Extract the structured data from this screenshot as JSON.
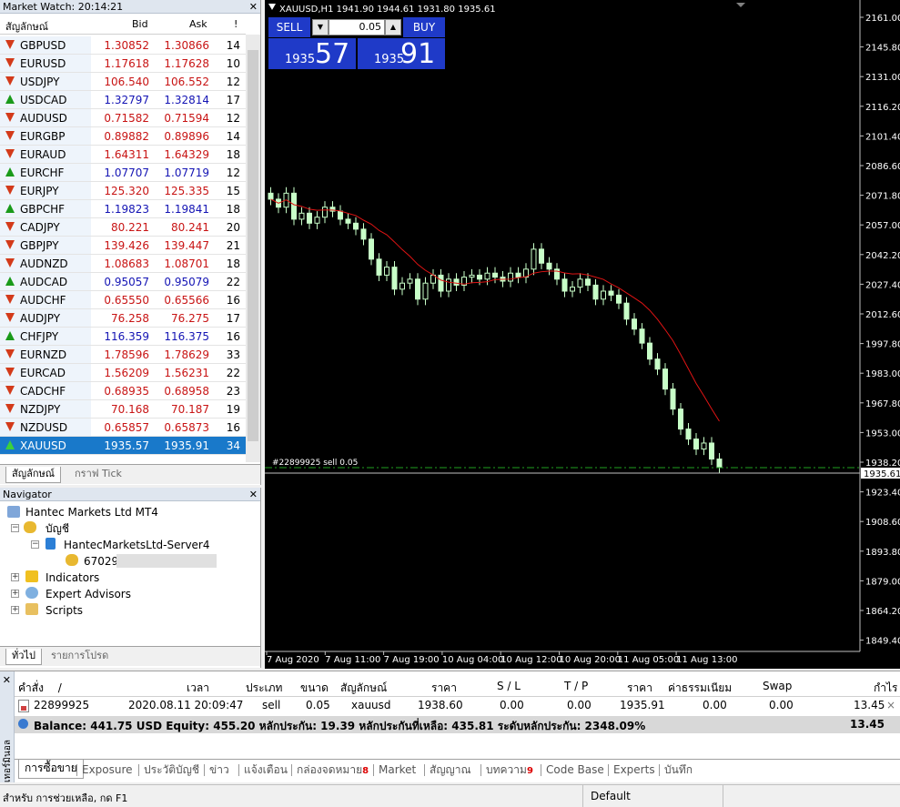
{
  "market_watch": {
    "title": "Market Watch: 20:14:21",
    "col_symbol": "สัญลักษณ์",
    "col_bid": "Bid",
    "col_ask": "Ask",
    "col_spread": "!",
    "rows": [
      {
        "symbol": "GBPUSD",
        "bid": "1.30852",
        "ask": "1.30866",
        "spread": "14",
        "dir": "down"
      },
      {
        "symbol": "EURUSD",
        "bid": "1.17618",
        "ask": "1.17628",
        "spread": "10",
        "dir": "down"
      },
      {
        "symbol": "USDJPY",
        "bid": "106.540",
        "ask": "106.552",
        "spread": "12",
        "dir": "down"
      },
      {
        "symbol": "USDCAD",
        "bid": "1.32797",
        "ask": "1.32814",
        "spread": "17",
        "dir": "up"
      },
      {
        "symbol": "AUDUSD",
        "bid": "0.71582",
        "ask": "0.71594",
        "spread": "12",
        "dir": "down"
      },
      {
        "symbol": "EURGBP",
        "bid": "0.89882",
        "ask": "0.89896",
        "spread": "14",
        "dir": "down"
      },
      {
        "symbol": "EURAUD",
        "bid": "1.64311",
        "ask": "1.64329",
        "spread": "18",
        "dir": "down"
      },
      {
        "symbol": "EURCHF",
        "bid": "1.07707",
        "ask": "1.07719",
        "spread": "12",
        "dir": "up"
      },
      {
        "symbol": "EURJPY",
        "bid": "125.320",
        "ask": "125.335",
        "spread": "15",
        "dir": "down"
      },
      {
        "symbol": "GBPCHF",
        "bid": "1.19823",
        "ask": "1.19841",
        "spread": "18",
        "dir": "up"
      },
      {
        "symbol": "CADJPY",
        "bid": "80.221",
        "ask": "80.241",
        "spread": "20",
        "dir": "down"
      },
      {
        "symbol": "GBPJPY",
        "bid": "139.426",
        "ask": "139.447",
        "spread": "21",
        "dir": "down"
      },
      {
        "symbol": "AUDNZD",
        "bid": "1.08683",
        "ask": "1.08701",
        "spread": "18",
        "dir": "down"
      },
      {
        "symbol": "AUDCAD",
        "bid": "0.95057",
        "ask": "0.95079",
        "spread": "22",
        "dir": "up"
      },
      {
        "symbol": "AUDCHF",
        "bid": "0.65550",
        "ask": "0.65566",
        "spread": "16",
        "dir": "down"
      },
      {
        "symbol": "AUDJPY",
        "bid": "76.258",
        "ask": "76.275",
        "spread": "17",
        "dir": "down"
      },
      {
        "symbol": "CHFJPY",
        "bid": "116.359",
        "ask": "116.375",
        "spread": "16",
        "dir": "up"
      },
      {
        "symbol": "EURNZD",
        "bid": "1.78596",
        "ask": "1.78629",
        "spread": "33",
        "dir": "down"
      },
      {
        "symbol": "EURCAD",
        "bid": "1.56209",
        "ask": "1.56231",
        "spread": "22",
        "dir": "down"
      },
      {
        "symbol": "CADCHF",
        "bid": "0.68935",
        "ask": "0.68958",
        "spread": "23",
        "dir": "down"
      },
      {
        "symbol": "NZDJPY",
        "bid": "70.168",
        "ask": "70.187",
        "spread": "19",
        "dir": "down"
      },
      {
        "symbol": "NZDUSD",
        "bid": "0.65857",
        "ask": "0.65873",
        "spread": "16",
        "dir": "down"
      },
      {
        "symbol": "XAUUSD",
        "bid": "1935.57",
        "ask": "1935.91",
        "spread": "34",
        "dir": "up",
        "selected": true
      }
    ],
    "tab_symbols": "สัญลักษณ์",
    "tab_tick": "กราฟ Tick"
  },
  "navigator": {
    "title": "Navigator",
    "root": "Hantec Markets Ltd MT4",
    "accounts": "บัญชี",
    "server": "HantecMarketsLtd-Server4",
    "account_no": "67029:",
    "indicators": "Indicators",
    "expert_advisors": "Expert Advisors",
    "scripts": "Scripts",
    "tab_common": "ทั่วไป",
    "tab_favorites": "รายการโปรด"
  },
  "chart": {
    "header": "XAUUSD,H1  1941.90 1944.61 1931.80 1935.61",
    "sell_label": "SELL",
    "buy_label": "BUY",
    "lot": "0.05",
    "sell_price_small": "1935",
    "sell_price_big": "57",
    "buy_price_small": "1935",
    "buy_price_big": "91",
    "order_line_label": "#22899925 sell 0.05",
    "current_price_label": "1935.61",
    "price_axis": [
      "2161.00",
      "2145.80",
      "2131.00",
      "2116.20",
      "2101.40",
      "2086.60",
      "2071.80",
      "2057.00",
      "2042.20",
      "2027.40",
      "2012.60",
      "1997.80",
      "1983.00",
      "1967.80",
      "1953.00",
      "1938.20",
      "1923.40",
      "1908.60",
      "1893.80",
      "1879.00",
      "1864.20",
      "1849.40"
    ],
    "time_axis": [
      "7 Aug 2020",
      "7 Aug 11:00",
      "7 Aug 19:00",
      "10 Aug 04:00",
      "10 Aug 12:00",
      "10 Aug 20:00",
      "11 Aug 05:00",
      "11 Aug 13:00"
    ],
    "colors": {
      "bg": "#000000",
      "candle": "#c8ffc8",
      "ma": "#e01414",
      "order_line": "#1fa01f",
      "bid_line": "#c0c0c0"
    }
  },
  "terminal": {
    "side_label": "เทอร์มินอล",
    "headers": {
      "order": "คำสั่ง",
      "time": "เวลา",
      "type": "ประเภท",
      "size": "ขนาด",
      "symbol": "สัญลักษณ์",
      "price": "ราคา",
      "sl": "S / L",
      "tp": "T / P",
      "cur_price": "ราคา",
      "commission": "ค่าธรรมเนียม",
      "swap": "Swap",
      "profit": "กำไร"
    },
    "sort_marker": "/",
    "order_row": {
      "order": "22899925",
      "time": "2020.08.11 20:09:47",
      "type": "sell",
      "size": "0.05",
      "symbol": "xauusd",
      "price": "1938.60",
      "sl": "0.00",
      "tp": "0.00",
      "cur_price": "1935.91",
      "commission": "0.00",
      "swap": "0.00",
      "profit": "13.45"
    },
    "close_glyph": "×",
    "balance_line": "Balance: 441.75 USD  Equity: 455.20  หลักประกัน: 19.39  หลักประกันที่เหลือ: 435.81  ระดับหลักประกัน: 2348.09%",
    "balance_profit": "13.45",
    "tabs": [
      {
        "label": "การซื้อขาย",
        "badge": ""
      },
      {
        "label": "Exposure",
        "badge": ""
      },
      {
        "label": "ประวัติบัญชี",
        "badge": ""
      },
      {
        "label": "ข่าว",
        "badge": ""
      },
      {
        "label": "แจ้งเตือน",
        "badge": ""
      },
      {
        "label": "กล่องจดหมาย",
        "badge": "8"
      },
      {
        "label": "Market",
        "badge": ""
      },
      {
        "label": "สัญญาณ",
        "badge": ""
      },
      {
        "label": "บทความ",
        "badge": "9"
      },
      {
        "label": "Code Base",
        "badge": ""
      },
      {
        "label": "Experts",
        "badge": ""
      },
      {
        "label": "บันทึก",
        "badge": ""
      }
    ]
  },
  "status_bar": {
    "help": "สำหรับ การช่วยเหลือ, กด F1",
    "profile": "Default"
  }
}
